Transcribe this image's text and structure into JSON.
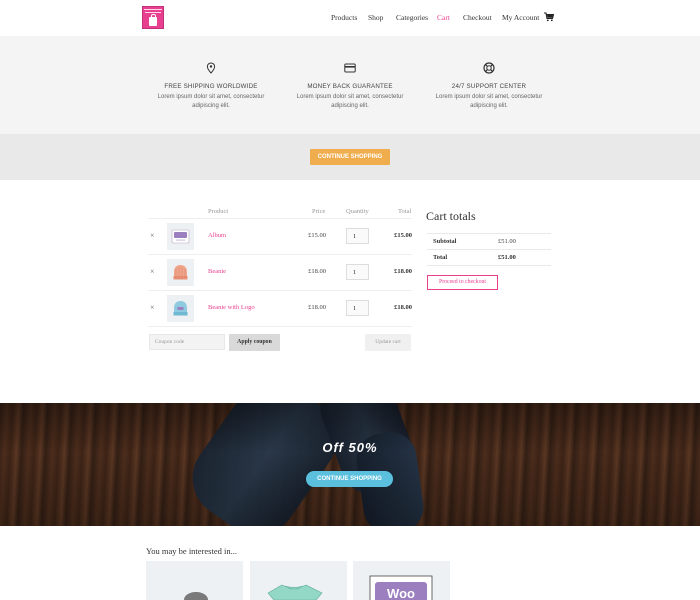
{
  "header": {
    "logo_icon": "store-bag-logo",
    "nav": [
      "Products",
      "Shop",
      "Categories",
      "Cart",
      "Checkout",
      "My Account"
    ],
    "active": "Cart",
    "cart_icon": "cart-icon",
    "accent": "#e83f8f"
  },
  "features": [
    {
      "icon": "location-pin-icon",
      "title": "FREE SHIPPING WORLDWIDE",
      "text_line1": "Lorem ipsum dolor sit amet, consectetur",
      "text_line2": "adipiscing elit."
    },
    {
      "icon": "credit-card-icon",
      "title": "MONEY BACK GUARANTEE",
      "text_line1": "Lorem ipsum dolor sit amet, consectetur",
      "text_line2": "adipiscing elit."
    },
    {
      "icon": "lifebuoy-icon",
      "title": "24/7 SUPPORT CENTER",
      "text_line1": "Lorem ipsum dolor sit amet, consectetur",
      "text_line2": "adipiscing elit."
    }
  ],
  "continue_button": "CONTINUE SHOPPING",
  "cart": {
    "headers": {
      "product": "Product",
      "price": "Price",
      "quantity": "Quantity",
      "total": "Total"
    },
    "items": [
      {
        "remove": "×",
        "name": "Album",
        "price": "£15.00",
        "qty": "1",
        "total": "£15.00",
        "thumb": "album-thumbnail"
      },
      {
        "remove": "×",
        "name": "Beanie",
        "price": "£18.00",
        "qty": "1",
        "total": "£18.00",
        "thumb": "beanie-thumbnail"
      },
      {
        "remove": "×",
        "name": "Beanie with Logo",
        "price": "£18.00",
        "qty": "1",
        "total": "£18.00",
        "thumb": "beanie-logo-thumbnail"
      }
    ],
    "coupon_placeholder": "Coupon code",
    "apply_coupon": "Apply coupon",
    "update_cart": "Update cart"
  },
  "totals": {
    "title": "Cart totals",
    "subtotal_label": "Subtotal",
    "subtotal": "£51.00",
    "total_label": "Total",
    "total": "£51.00",
    "checkout": "Proceed to checkout"
  },
  "promo": {
    "title": "Off 50%",
    "button": "CONTINUE SHOPPING",
    "button_color": "#5bc0de"
  },
  "interested": {
    "title": "You may be interested in...",
    "cards": [
      "cap-thumbnail",
      "tshirt-thumbnail",
      "poster-thumbnail"
    ],
    "poster_text": "Woo"
  },
  "colors": {
    "orange": "#f0ad4e",
    "blue": "#5bc0de",
    "pink": "#e83f8f"
  }
}
